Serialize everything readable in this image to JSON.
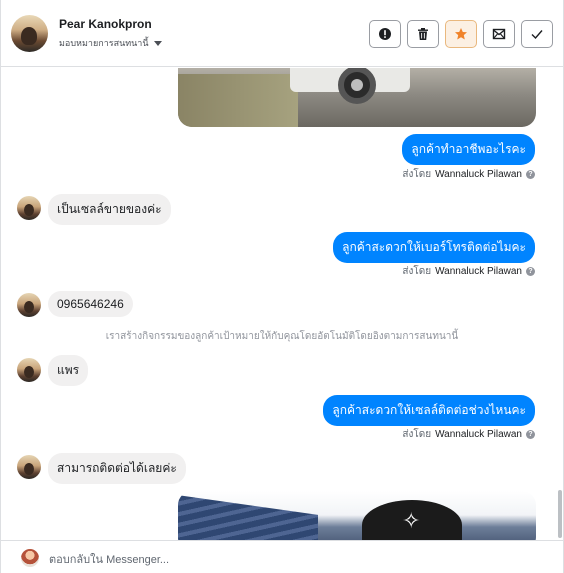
{
  "header": {
    "contact_name": "Pear Kanokpron",
    "assign_label": "มอบหมายการสนทนานี้",
    "tools": [
      {
        "name": "mark-spam-button",
        "icon": "exclamation-icon"
      },
      {
        "name": "delete-button",
        "icon": "trash-icon"
      },
      {
        "name": "star-button",
        "icon": "star-icon",
        "accent": "#f0832a"
      },
      {
        "name": "mark-unread-button",
        "icon": "envelope-icon"
      },
      {
        "name": "mark-done-button",
        "icon": "check-icon"
      }
    ]
  },
  "messages": {
    "out1": "ลูกค้าทำอาชีพอะไรคะ",
    "sent_prefix": "ส่งโดย",
    "sent_by_1": "Wannaluck Pilawan",
    "in1": "เป็นเซลล์ขายของค่ะ",
    "out2": "ลูกค้าสะดวกให้เบอร์โทรติดต่อไมคะ",
    "sent_by_2": "Wannaluck Pilawan",
    "in2": "0965646246",
    "system_note": "เราสร้างกิจกรรมของลูกค้าเป้าหมายให้กับคุณโดยอัตโนมัติโดยอิงตามการสนทนานี้",
    "in3": "แพร",
    "out3": "ลูกค้าสะดวกให้เซลล์ติดต่อช่วงไหนคะ",
    "sent_by_3": "Wannaluck Pilawan",
    "in4": "สามารถติดต่อได้เลยค่ะ"
  },
  "composer": {
    "placeholder": "ตอบกลับใน Messenger..."
  },
  "colors": {
    "outgoing_bubble": "#0084ff",
    "incoming_bubble": "#f1f0f0"
  }
}
